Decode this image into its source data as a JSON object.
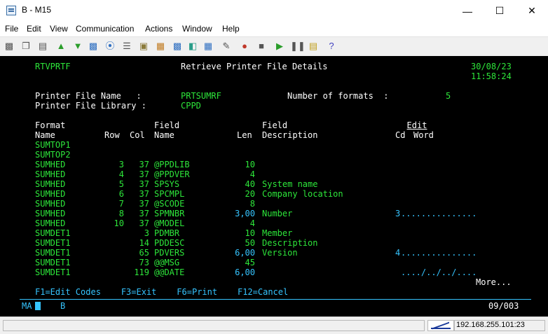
{
  "window": {
    "title": "B - M15",
    "minimize": "—",
    "maximize": "☐",
    "close": "✕"
  },
  "menu": [
    "File",
    "Edit",
    "View",
    "Communication",
    "Actions",
    "Window",
    "Help"
  ],
  "toolbar_icons": [
    "print-screen-icon",
    "copy-icon",
    "paste-icon",
    "send-icon",
    "receive-icon",
    "display-icon",
    "navigator-icon",
    "notes-icon",
    "macro-icon",
    "quick-keys-icon",
    "color-map-icon",
    "keyboard-map-icon",
    "grid-icon",
    "edit-icon",
    "record-macro-icon",
    "stop-macro-icon",
    "play-macro-icon",
    "pause-macro-icon",
    "notepad-icon",
    "help-icon"
  ],
  "screen": {
    "program": "RTVPRTF",
    "title": "Retrieve Printer File Details",
    "date": "30/08/23",
    "time": "11:58:24",
    "file_name_label": "Printer File Name   :",
    "file_name": "PRTSUMRF",
    "formats_label": "Number of formats  :",
    "formats_count": "5",
    "library_label": "Printer File Library :",
    "library": "CPPD",
    "header1": {
      "format": "Format",
      "field": "Field",
      "field2": "Field",
      "edit": "Edit"
    },
    "header2": {
      "name": "Name",
      "row": "Row",
      "col": "Col",
      "fname": "Name",
      "len": "Len",
      "desc": "Description",
      "cd": "Cd",
      "word": "Word"
    },
    "rows": [
      {
        "format": "SUMTOP1",
        "row": "",
        "col": "",
        "name": "",
        "len": "",
        "desc": "",
        "cd": "",
        "word": ""
      },
      {
        "format": "SUMTOP2",
        "row": "",
        "col": "",
        "name": "",
        "len": "",
        "desc": "",
        "cd": "",
        "word": ""
      },
      {
        "format": "SUMHED",
        "row": "3",
        "col": "37",
        "name": "@PPDLIB",
        "len": "10",
        "desc": "",
        "cd": "",
        "word": ""
      },
      {
        "format": "SUMHED",
        "row": "4",
        "col": "37",
        "name": "@PPDVER",
        "len": "4",
        "desc": "",
        "cd": "",
        "word": ""
      },
      {
        "format": "SUMHED",
        "row": "5",
        "col": "37",
        "name": "SPSYS",
        "len": "40",
        "desc": "System name",
        "cd": "",
        "word": ""
      },
      {
        "format": "SUMHED",
        "row": "6",
        "col": "37",
        "name": "SPCMPL",
        "len": "20",
        "desc": "Company location",
        "cd": "",
        "word": ""
      },
      {
        "format": "SUMHED",
        "row": "7",
        "col": "37",
        "name": "@SCODE",
        "len": "8",
        "desc": "",
        "cd": "",
        "word": ""
      },
      {
        "format": "SUMHED",
        "row": "8",
        "col": "37",
        "name": "SPMNBR",
        "len": "3,00",
        "desc": "Number",
        "cd": "3",
        "word": "..............."
      },
      {
        "format": "SUMHED",
        "row": "10",
        "col": "37",
        "name": "@MODEL",
        "len": "4",
        "desc": "",
        "cd": "",
        "word": ""
      },
      {
        "format": "SUMDET1",
        "row": "",
        "col": "3",
        "name": "PDMBR",
        "len": "10",
        "desc": "Member",
        "cd": "",
        "word": ""
      },
      {
        "format": "SUMDET1",
        "row": "",
        "col": "14",
        "name": "PDDESC",
        "len": "50",
        "desc": "Description",
        "cd": "",
        "word": ""
      },
      {
        "format": "SUMDET1",
        "row": "",
        "col": "65",
        "name": "PDVERS",
        "len": "6,00",
        "desc": "Version",
        "cd": "4",
        "word": "..............."
      },
      {
        "format": "SUMDET1",
        "row": "",
        "col": "73",
        "name": "@@MSG",
        "len": "45",
        "desc": "",
        "cd": "",
        "word": ""
      },
      {
        "format": "SUMDET1",
        "row": "",
        "col": "119",
        "name": "@@DATE",
        "len": "6,00",
        "desc": "",
        "cd": "",
        "word": "..../../../...."
      }
    ],
    "more": "More...",
    "fkeys": "F1=Edit Codes    F3=Exit    F6=Print    F12=Cancel",
    "oia_left": "MA",
    "oia_session": "B",
    "oia_pos": "09/003"
  },
  "status": {
    "ip": "192.168.255.101:23"
  }
}
